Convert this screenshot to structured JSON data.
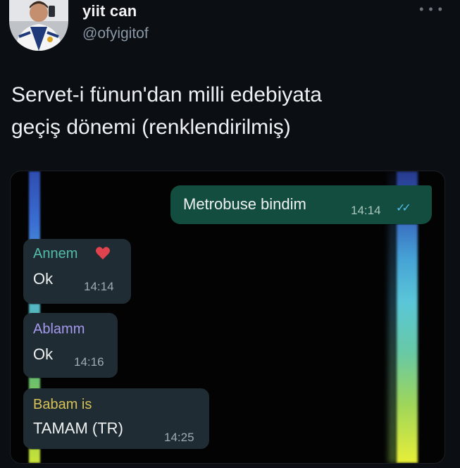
{
  "user": {
    "display_name": "yiit can",
    "handle": "@ofyigitof",
    "avatar_icon": "profile-photo-icon"
  },
  "more_icon": "ellipsis-icon",
  "tweet": {
    "text_line1": "Servet-i fünun'dan milli edebiyata",
    "text_line2": "geçiş dönemi (renklendirilmiş)"
  },
  "chat": {
    "outgoing": {
      "text": "Metrobuse bindim",
      "time": "14:14",
      "status_icon": "double-check-icon"
    },
    "messages": [
      {
        "sender": "Annem",
        "sender_color": "#53bdaa",
        "emoji": "heart-icon",
        "text": "Ok",
        "time": "14:14"
      },
      {
        "sender": "Ablamm",
        "sender_color": "#a69af0",
        "text": "Ok",
        "time": "14:16"
      },
      {
        "sender": "Babam is",
        "sender_color": "#d6c256",
        "text": "TAMAM (TR)",
        "time": "14:25"
      }
    ]
  },
  "colors": {
    "background": "#0b0e13",
    "bubble_incoming": "#202c33",
    "bubble_outgoing": "#134d3f",
    "read_ticks": "#53bdeb"
  }
}
